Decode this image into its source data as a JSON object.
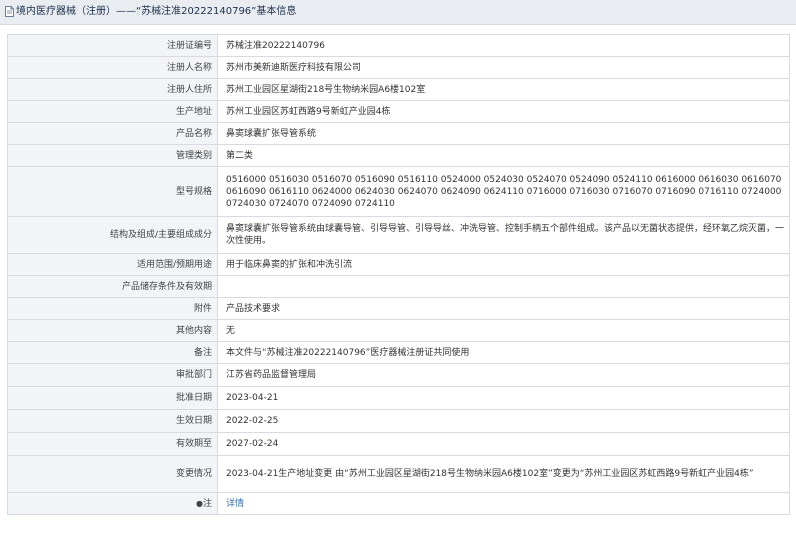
{
  "header": {
    "icon": "document-icon",
    "prefix": "境内医疗器械（注册）",
    "dash": "——",
    "record_link": "“苏械注准20222140796”",
    "suffix": "基本信息"
  },
  "rows": [
    {
      "label": "注册证编号",
      "value": "苏械注准20222140796"
    },
    {
      "label": "注册人名称",
      "value": "苏州市美新迪斯医疗科技有限公司"
    },
    {
      "label": "注册人住所",
      "value": "苏州工业园区星湖街218号生物纳米园A6楼102室"
    },
    {
      "label": "生产地址",
      "value": "苏州工业园区苏虹西路9号新虹产业园4栋"
    },
    {
      "label": "产品名称",
      "value": "鼻窦球囊扩张导管系统"
    },
    {
      "label": "管理类别",
      "value": "第二类"
    },
    {
      "label": "型号规格",
      "value": "0516000 0516030 0516070 0516090 0516110 0524000 0524030 0524070 0524090 0524110 0616000 0616030 0616070 0616090 0616110 0624000 0624030 0624070 0624090 0624110 0716000 0716030 0716070 0716090 0716110 0724000 0724030 0724070 0724090 0724110"
    },
    {
      "label": "结构及组成/主要组成成分",
      "value": "鼻窦球囊扩张导管系统由球囊导管、引导导管、引导导丝、冲洗导管、控制手柄五个部件组成。该产品以无菌状态提供，经环氧乙烷灭菌，一次性使用。"
    },
    {
      "label": "适用范围/预期用途",
      "value": "用于临床鼻窦的扩张和冲洗引流"
    },
    {
      "label": "产品储存条件及有效期",
      "value": ""
    },
    {
      "label": "附件",
      "value": "产品技术要求"
    },
    {
      "label": "其他内容",
      "value": "无"
    },
    {
      "label": "备注",
      "value": "本文件与“苏械注准20222140796”医疗器械注册证共同使用"
    },
    {
      "label": "审批部门",
      "value": "江苏省药品监督管理局"
    },
    {
      "label": "批准日期",
      "value": "2023-04-21"
    },
    {
      "label": "生效日期",
      "value": "2022-02-25"
    },
    {
      "label": "有效期至",
      "value": "2027-02-24"
    },
    {
      "label": "变更情况",
      "value": "2023-04-21生产地址变更 由“苏州工业园区星湖街218号生物纳米园A6楼102室”变更为“苏州工业园区苏虹西路9号新虹产业园4栋”"
    }
  ],
  "note": {
    "dot": "●",
    "label": "注",
    "link": "详情"
  },
  "colors": {
    "header_bg": "#e9edf2",
    "label_bg": "#f2f4f7",
    "border": "#d6dbe3",
    "link": "#3a6fb0"
  }
}
